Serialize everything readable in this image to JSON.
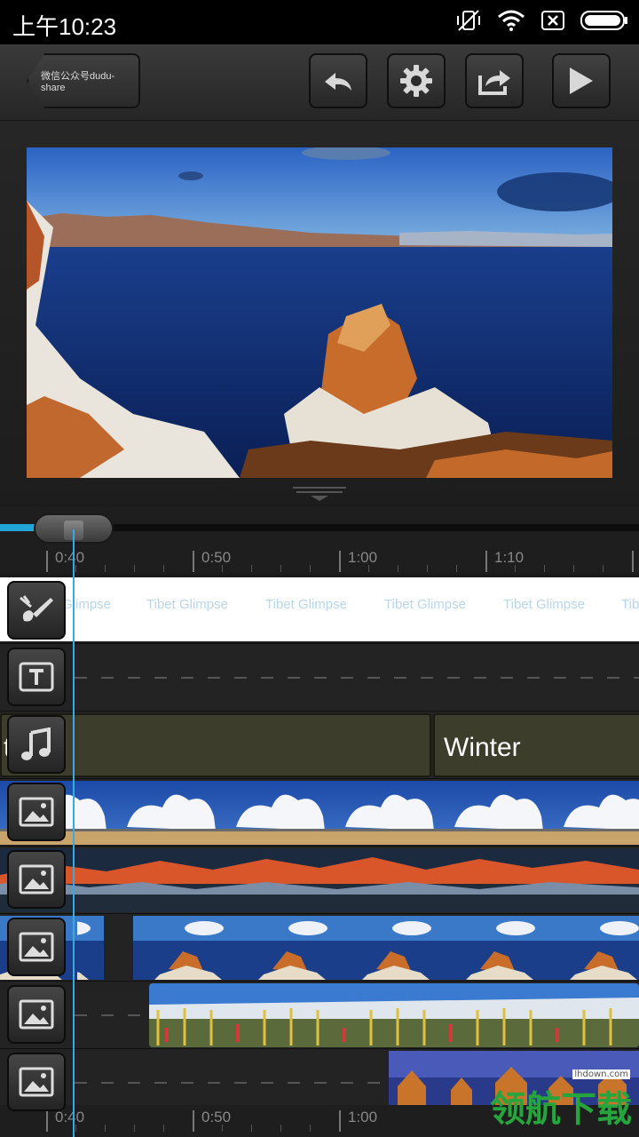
{
  "status_bar": {
    "time": "上午10:23"
  },
  "toolbar": {
    "back_label": "微信公众号dudu-share",
    "undo_icon": "undo-icon",
    "settings_icon": "gear-icon",
    "share_icon": "share-icon",
    "play_icon": "play-icon"
  },
  "ruler_top": {
    "labels": [
      "0:40",
      "0:50",
      "1:00",
      "1:10"
    ]
  },
  "ruler_bottom": {
    "labels": [
      "0:40",
      "0:50",
      "1:00"
    ]
  },
  "tracks": {
    "theme": {
      "text": "Tibet Glimpse",
      "prefix": "Glimpse",
      "suffix": "Tib"
    },
    "text_track_icon": "text-icon",
    "music": {
      "clip_2_label": "Winter",
      "clip_1_tail": "t"
    }
  },
  "watermark": {
    "text": "领航下载",
    "sub": "lhdown.com"
  }
}
